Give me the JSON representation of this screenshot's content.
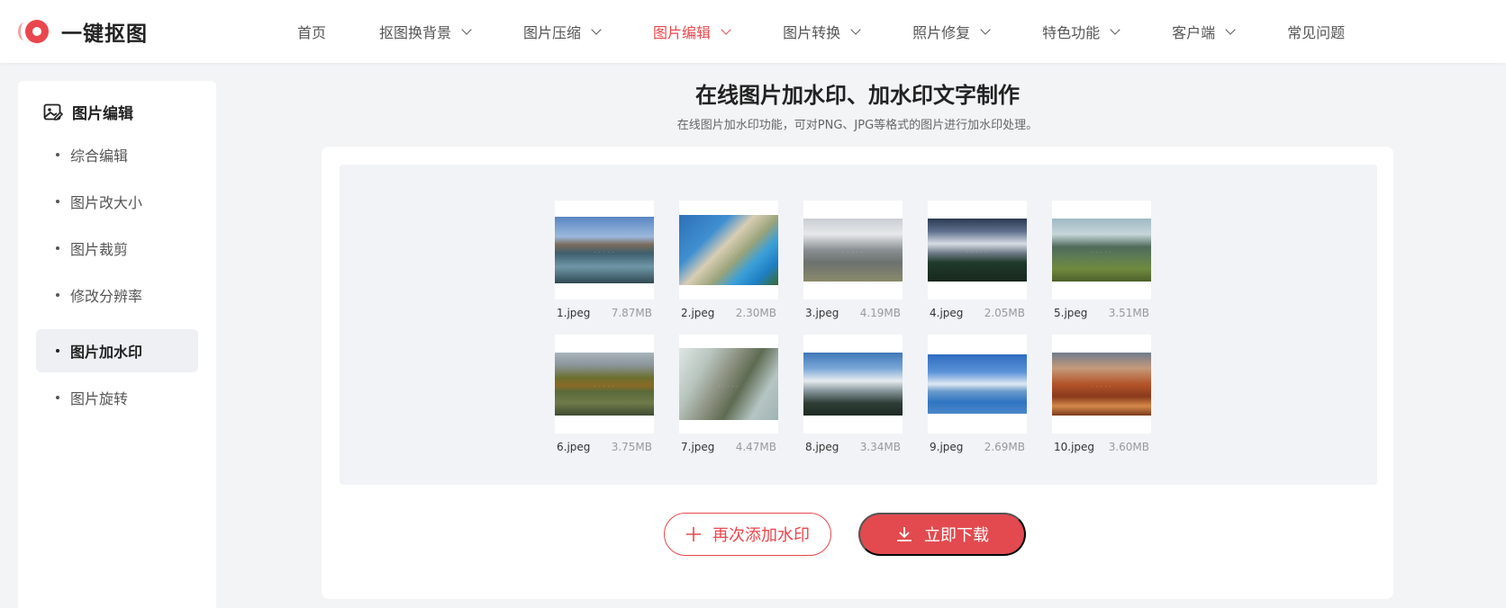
{
  "brand": {
    "name": "一键抠图",
    "accent": "#e9474d"
  },
  "nav": {
    "items": [
      {
        "label": "首页",
        "dropdown": false
      },
      {
        "label": "抠图换背景",
        "dropdown": true
      },
      {
        "label": "图片压缩",
        "dropdown": true
      },
      {
        "label": "图片编辑",
        "dropdown": true,
        "active": true
      },
      {
        "label": "图片转换",
        "dropdown": true
      },
      {
        "label": "照片修复",
        "dropdown": true
      },
      {
        "label": "特色功能",
        "dropdown": true
      },
      {
        "label": "客户端",
        "dropdown": true
      },
      {
        "label": "常见问题",
        "dropdown": false
      }
    ]
  },
  "sidebar": {
    "title": "图片编辑",
    "title_icon": "image-edit-icon",
    "items": [
      {
        "label": "综合编辑"
      },
      {
        "label": "图片改大小"
      },
      {
        "label": "图片裁剪"
      },
      {
        "label": "修改分辨率"
      },
      {
        "label": "图片加水印",
        "active": true
      },
      {
        "label": "图片旋转"
      }
    ]
  },
  "main": {
    "title": "在线图片加水印、加水印文字制作",
    "description": "在线图片加水印功能，可对PNG、JPG等格式的图片进行加水印处理。",
    "files": [
      {
        "name": "1.jpeg",
        "size": "7.87MB"
      },
      {
        "name": "2.jpeg",
        "size": "2.30MB"
      },
      {
        "name": "3.jpeg",
        "size": "4.19MB"
      },
      {
        "name": "4.jpeg",
        "size": "2.05MB"
      },
      {
        "name": "5.jpeg",
        "size": "3.51MB"
      },
      {
        "name": "6.jpeg",
        "size": "3.75MB"
      },
      {
        "name": "7.jpeg",
        "size": "4.47MB"
      },
      {
        "name": "8.jpeg",
        "size": "3.34MB"
      },
      {
        "name": "9.jpeg",
        "size": "2.69MB"
      },
      {
        "name": "10.jpeg",
        "size": "3.60MB"
      }
    ],
    "buttons": {
      "add_label": "再次添加水印",
      "add_icon": "plus-icon",
      "download_label": "立即下载",
      "download_icon": "download-icon"
    }
  }
}
